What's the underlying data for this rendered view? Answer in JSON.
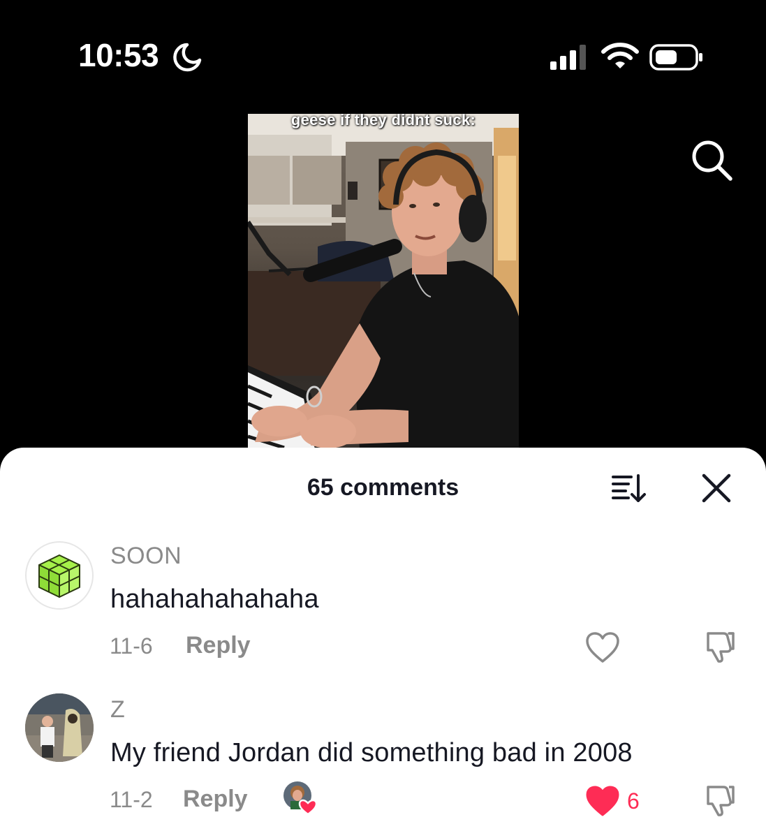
{
  "status_bar": {
    "time": "10:53"
  },
  "video": {
    "caption": "geese if they didnt suck:"
  },
  "comments_sheet": {
    "title": "65 comments",
    "comments": [
      {
        "username": "SOON",
        "text": "hahahahahahaha",
        "date": "11-6",
        "reply_label": "Reply",
        "liked": false
      },
      {
        "username": "Z",
        "text": "My friend Jordan did something bad in 2008",
        "date": "11-2",
        "reply_label": "Reply",
        "liked": true,
        "like_count": "6",
        "liked_by_creator": true
      }
    ]
  },
  "icons": {
    "status": [
      "moon-icon",
      "signal-icon",
      "wifi-icon",
      "battery-icon"
    ],
    "header": [
      "search-icon",
      "sort-icon",
      "close-icon"
    ],
    "comment_actions": [
      "heart-icon",
      "dislike-icon"
    ]
  },
  "colors": {
    "background": "#000000",
    "sheet": "#ffffff",
    "primary_text": "#161823",
    "secondary_text": "#8a8a8a",
    "like_red": "#fe2c55"
  }
}
